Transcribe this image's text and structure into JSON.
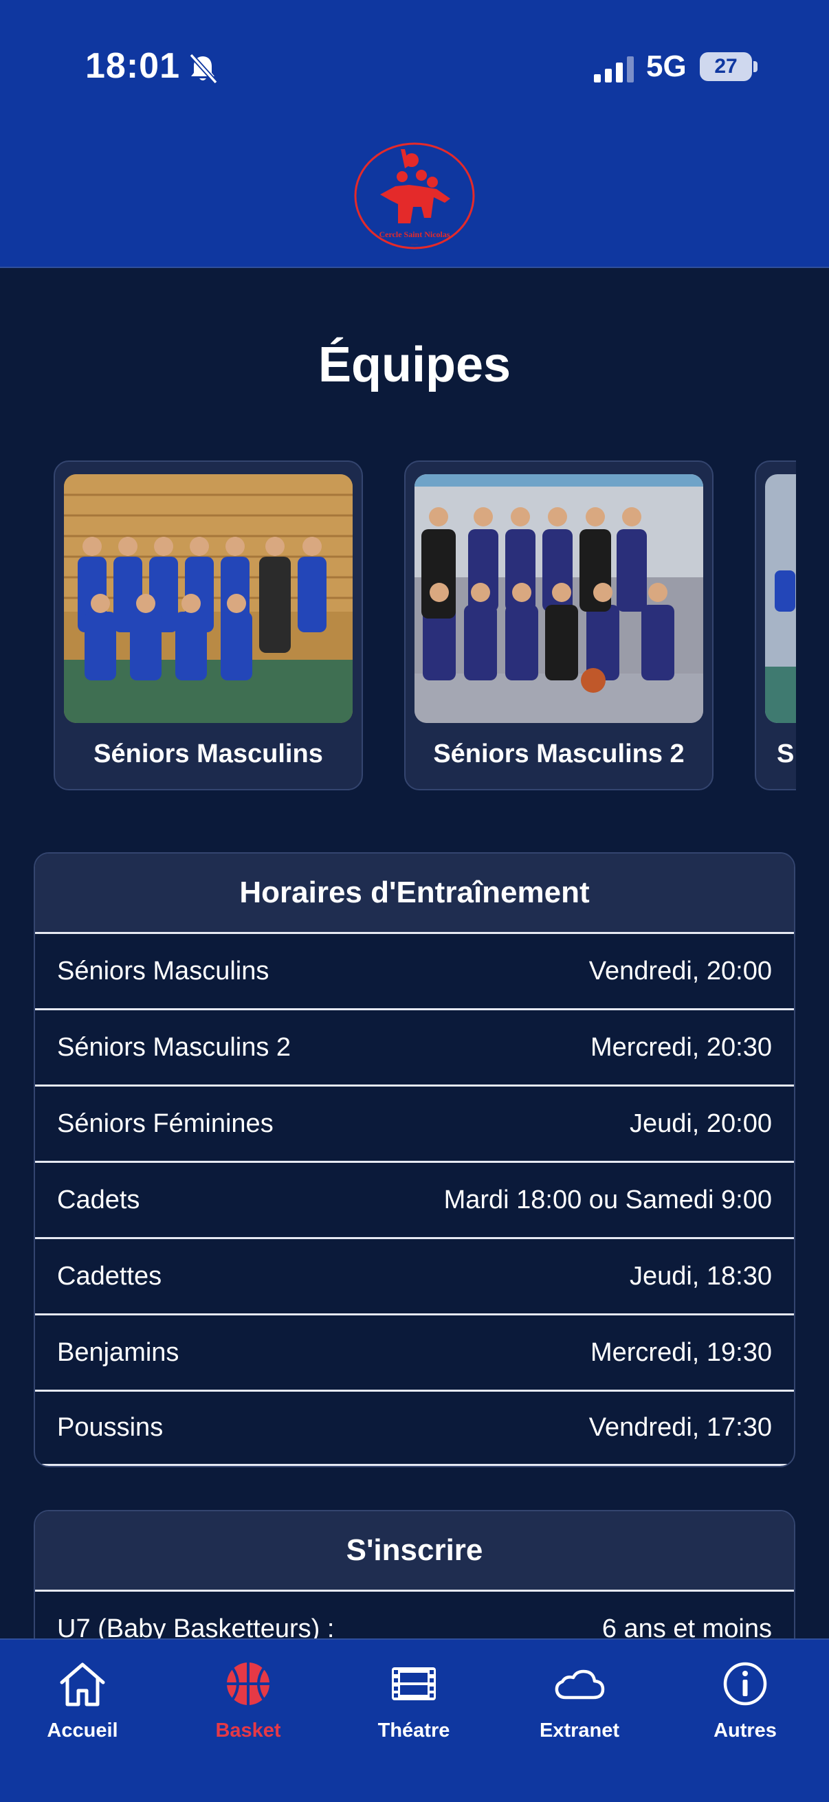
{
  "status": {
    "time": "18:01",
    "network": "5G",
    "battery": "27"
  },
  "header": {
    "logo_text": "Cercle Saint Nicolas"
  },
  "page_title": "Équipes",
  "teams": [
    {
      "name": "Séniors Masculins"
    },
    {
      "name": "Séniors Masculins 2"
    },
    {
      "name": "S"
    }
  ],
  "training": {
    "title": "Horaires d'Entraînement",
    "rows": [
      {
        "team": "Séniors Masculins",
        "schedule": "Vendredi, 20:00"
      },
      {
        "team": "Séniors Masculins 2",
        "schedule": "Mercredi, 20:30"
      },
      {
        "team": "Séniors Féminines",
        "schedule": "Jeudi, 20:00"
      },
      {
        "team": "Cadets",
        "schedule": "Mardi 18:00 ou Samedi 9:00"
      },
      {
        "team": "Cadettes",
        "schedule": "Jeudi, 18:30"
      },
      {
        "team": "Benjamins",
        "schedule": "Mercredi, 19:30"
      },
      {
        "team": "Poussins",
        "schedule": "Vendredi, 17:30"
      }
    ]
  },
  "signup": {
    "title": "S'inscrire",
    "rows": [
      {
        "category": "U7 (Baby Basketteurs) :",
        "age": "6 ans et moins"
      }
    ]
  },
  "tabs": [
    {
      "label": "Accueil",
      "icon": "home-icon"
    },
    {
      "label": "Basket",
      "icon": "basketball-icon",
      "active": true
    },
    {
      "label": "Théatre",
      "icon": "film-icon"
    },
    {
      "label": "Extranet",
      "icon": "cloud-icon"
    },
    {
      "label": "Autres",
      "icon": "info-icon"
    }
  ],
  "colors": {
    "header_bg": "#0f37a0",
    "page_bg": "#0b1a3a",
    "active_tab": "#e63946",
    "logo_red": "#e42a2a"
  }
}
